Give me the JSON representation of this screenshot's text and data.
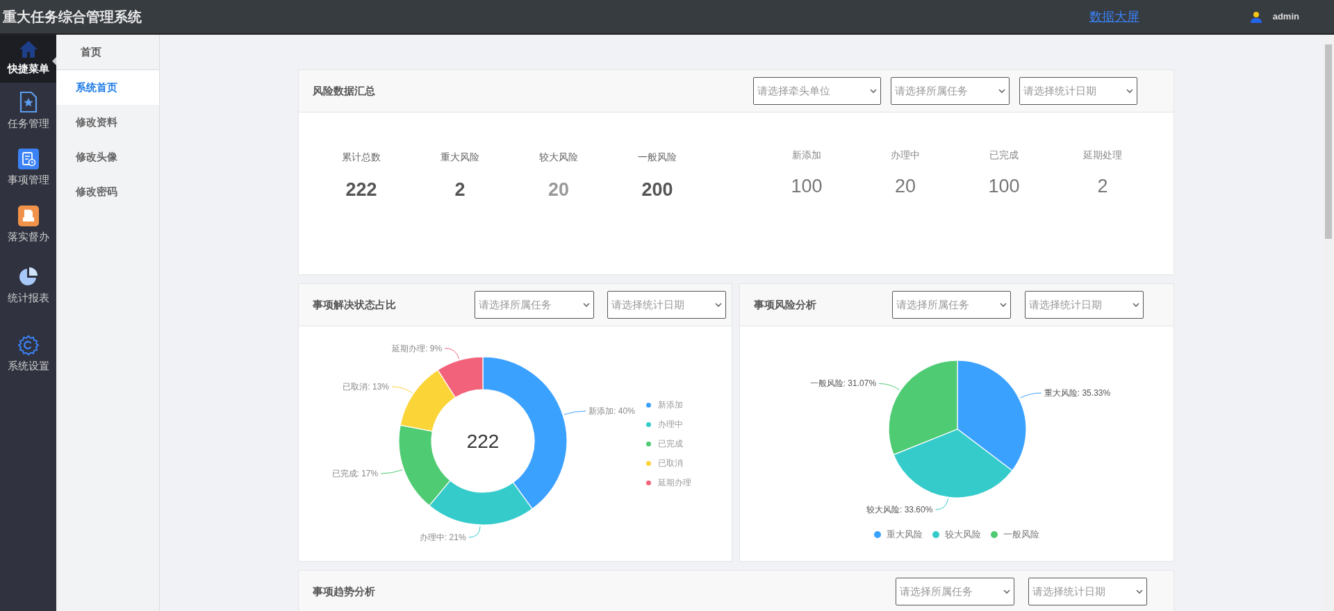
{
  "topbar": {
    "title": "重大任务综合管理系统",
    "link": "数据大屏",
    "user": "admin"
  },
  "sidebar": {
    "items": [
      {
        "label": "快捷菜单",
        "kind": "home",
        "selected": true
      },
      {
        "label": "任务管理",
        "kind": "doc",
        "selected": false
      },
      {
        "label": "事项管理",
        "kind": "list",
        "selected": false
      },
      {
        "label": "落实督办",
        "kind": "inbox",
        "selected": false
      },
      {
        "label": "统计报表",
        "kind": "pie",
        "selected": false
      },
      {
        "label": "系统设置",
        "kind": "gear",
        "selected": false
      }
    ]
  },
  "submenu": {
    "header": "首页",
    "items": [
      {
        "label": "系统首页",
        "selected": true
      },
      {
        "label": "修改资料",
        "selected": false
      },
      {
        "label": "修改头像",
        "selected": false
      },
      {
        "label": "修改密码",
        "selected": false
      }
    ]
  },
  "summary": {
    "title": "风险数据汇总",
    "filters": [
      {
        "placeholder": "请选择牵头单位"
      },
      {
        "placeholder": "请选择所属任务"
      },
      {
        "placeholder": "请选择统计日期"
      }
    ],
    "risk_stats": [
      {
        "label": "累计总数",
        "value": "222",
        "muted": false
      },
      {
        "label": "重大风险",
        "value": "2",
        "muted": false
      },
      {
        "label": "较大风险",
        "value": "20",
        "muted": true
      },
      {
        "label": "一般风险",
        "value": "200",
        "muted": false
      }
    ],
    "status_stats": [
      {
        "label": "新添加",
        "value": "100"
      },
      {
        "label": "办理中",
        "value": "20"
      },
      {
        "label": "已完成",
        "value": "100"
      },
      {
        "label": "延期处理",
        "value": "2"
      }
    ]
  },
  "status_card": {
    "title": "事项解决状态占比",
    "filters": [
      {
        "placeholder": "请选择所属任务"
      },
      {
        "placeholder": "请选择统计日期"
      }
    ],
    "center_label": "222",
    "chart_data": {
      "type": "donut",
      "categories": [
        "新添加",
        "办理中",
        "已完成",
        "已取消",
        "延期办理"
      ],
      "values": [
        40,
        21,
        17,
        13,
        9
      ],
      "colors": [
        "#3ba1ff",
        "#36cbcb",
        "#4ecb73",
        "#fbd437",
        "#f2637b"
      ],
      "value_labels": [
        "新添加: 40%",
        "办理中: 21%",
        "已完成: 17%",
        "已取消: 13%",
        "延期办理: 9%"
      ]
    }
  },
  "risk_card": {
    "title": "事项风险分析",
    "filters": [
      {
        "placeholder": "请选择所属任务"
      },
      {
        "placeholder": "请选择统计日期"
      }
    ],
    "chart_data": {
      "type": "pie",
      "categories": [
        "重大风险",
        "较大风险",
        "一般风险"
      ],
      "values": [
        35.33,
        33.6,
        31.07
      ],
      "colors": [
        "#3ba1ff",
        "#36cbcb",
        "#4ecb73"
      ],
      "value_labels": [
        "重大风险: 35.33%",
        "较大风险: 33.60%",
        "一般风险: 31.07%"
      ]
    }
  },
  "trend_card": {
    "title": "事项趋势分析",
    "filters": [
      {
        "placeholder": "请选择所属任务"
      },
      {
        "placeholder": "请选择统计日期"
      }
    ]
  }
}
